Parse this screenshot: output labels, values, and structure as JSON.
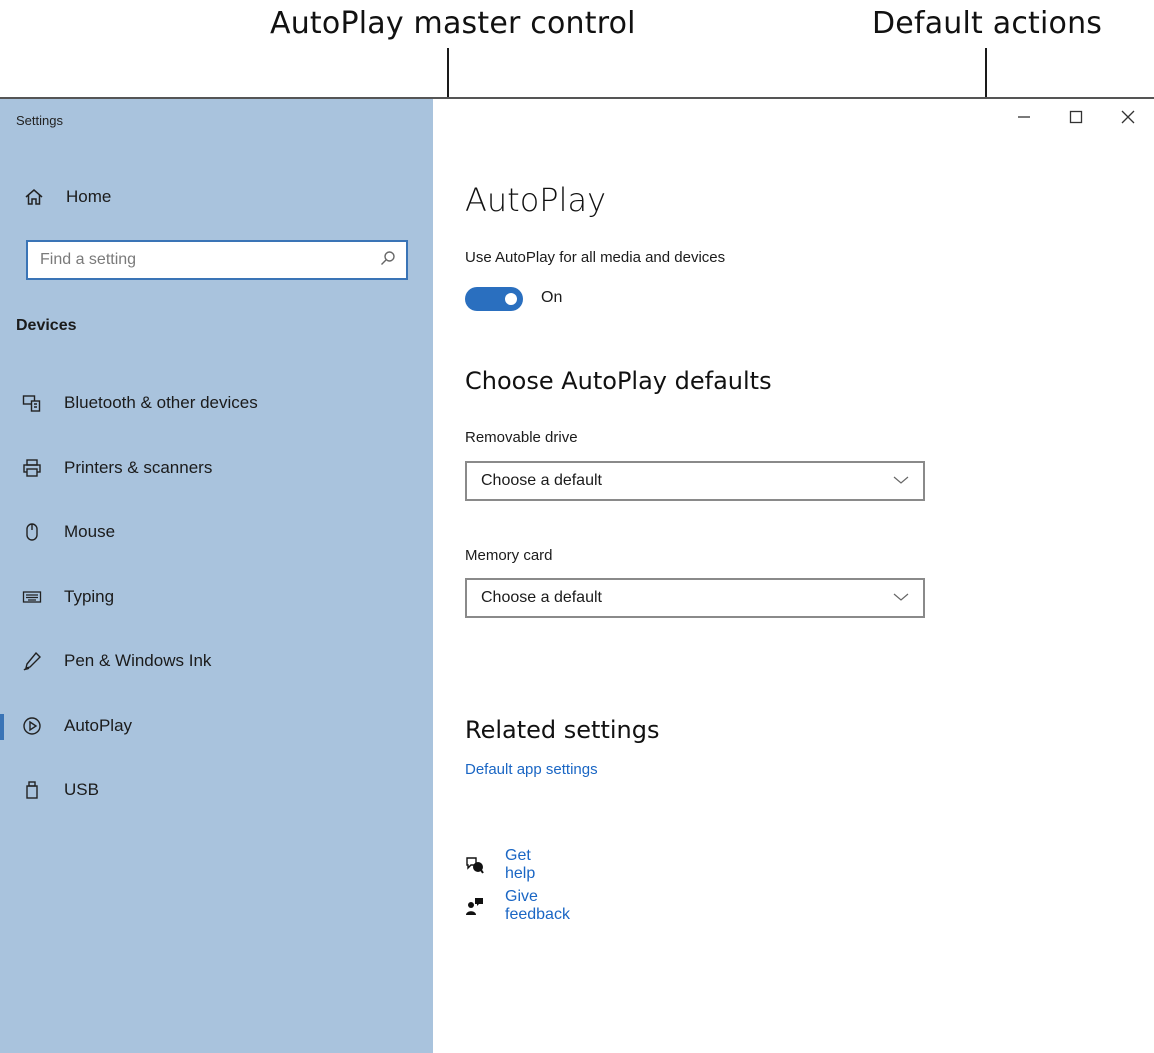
{
  "callouts": {
    "master": "AutoPlay master control",
    "defaults": "Default actions"
  },
  "window": {
    "app_title": "Settings",
    "controls": {
      "minimize": "–",
      "maximize": "☐",
      "close": "✕"
    }
  },
  "sidebar": {
    "home_label": "Home",
    "search_placeholder": "Find a setting",
    "section_title": "Devices",
    "items": [
      {
        "label": "Bluetooth & other devices",
        "icon": "bluetooth-devices-icon"
      },
      {
        "label": "Printers & scanners",
        "icon": "printer-icon"
      },
      {
        "label": "Mouse",
        "icon": "mouse-icon"
      },
      {
        "label": "Typing",
        "icon": "keyboard-icon"
      },
      {
        "label": "Pen & Windows Ink",
        "icon": "pen-icon"
      },
      {
        "label": "AutoPlay",
        "icon": "autoplay-icon",
        "selected": true
      },
      {
        "label": "USB",
        "icon": "usb-icon"
      }
    ]
  },
  "main": {
    "title": "AutoPlay",
    "toggle": {
      "label": "Use AutoPlay for all media and devices",
      "state_text": "On",
      "on": true
    },
    "defaults_title": "Choose AutoPlay defaults",
    "removable": {
      "label": "Removable drive",
      "value": "Choose a default"
    },
    "memory": {
      "label": "Memory card",
      "value": "Choose a default"
    },
    "related_title": "Related settings",
    "related_link": "Default app settings",
    "help": {
      "get_help": "Get help",
      "give_feedback": "Give feedback"
    }
  },
  "colors": {
    "sidebar_bg": "#a9c3dd",
    "accent": "#2a6fbf",
    "link": "#1a66c4"
  }
}
